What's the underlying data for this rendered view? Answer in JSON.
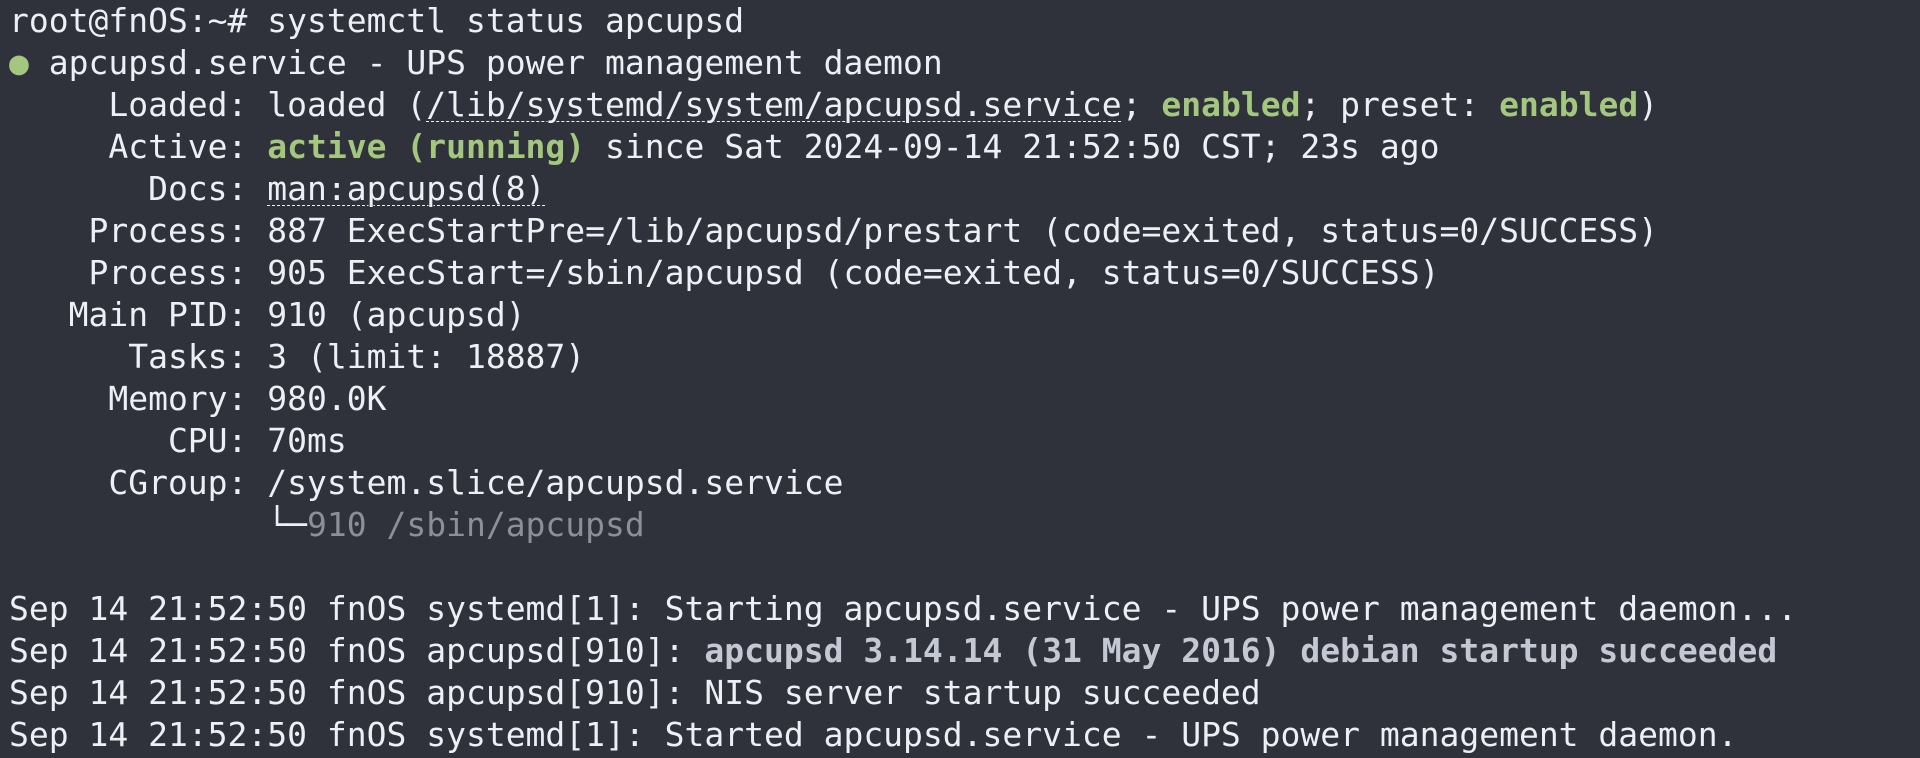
{
  "prompt": "root@fnOS:~# systemctl status apcupsd",
  "header": {
    "bullet": "●",
    "title": " apcupsd.service - UPS power management daemon"
  },
  "loaded": {
    "label": "     Loaded: ",
    "value_pre": "loaded (",
    "path": "/lib/systemd/system/apcupsd.service",
    "sep1": "; ",
    "enabled1": "enabled",
    "sep2": "; preset: ",
    "enabled2": "enabled",
    "close": ")"
  },
  "active": {
    "label": "     Active: ",
    "state": "active (running)",
    "rest": " since Sat 2024-09-14 21:52:50 CST; 23s ago"
  },
  "docs": {
    "label": "       Docs: ",
    "value": "man:apcupsd(8)"
  },
  "process1": {
    "label": "    Process: ",
    "value": "887 ExecStartPre=/lib/apcupsd/prestart (code=exited, status=0/SUCCESS)"
  },
  "process2": {
    "label": "    Process: ",
    "value": "905 ExecStart=/sbin/apcupsd (code=exited, status=0/SUCCESS)"
  },
  "mainpid": {
    "label": "   Main PID: ",
    "value": "910 (apcupsd)"
  },
  "tasks": {
    "label": "      Tasks: ",
    "value": "3 (limit: 18887)"
  },
  "memory": {
    "label": "     Memory: ",
    "value": "980.0K"
  },
  "cpu": {
    "label": "        CPU: ",
    "value": "70ms"
  },
  "cgroup": {
    "label": "     CGroup: ",
    "value": "/system.slice/apcupsd.service",
    "tree_prefix": "             └─",
    "child": "910 /sbin/apcupsd"
  },
  "logs": [
    {
      "prefix": "Sep 14 21:52:50 fnOS systemd[1]: ",
      "msg": "Starting apcupsd.service - UPS power management daemon..."
    },
    {
      "prefix": "Sep 14 21:52:50 fnOS apcupsd[910]: ",
      "msg": "apcupsd 3.14.14 (31 May 2016) debian startup succeeded"
    },
    {
      "prefix": "Sep 14 21:52:50 fnOS apcupsd[910]: ",
      "msg": "NIS server startup succeeded"
    },
    {
      "prefix": "Sep 14 21:52:50 fnOS systemd[1]: ",
      "msg": "Started apcupsd.service - UPS power management daemon."
    }
  ]
}
